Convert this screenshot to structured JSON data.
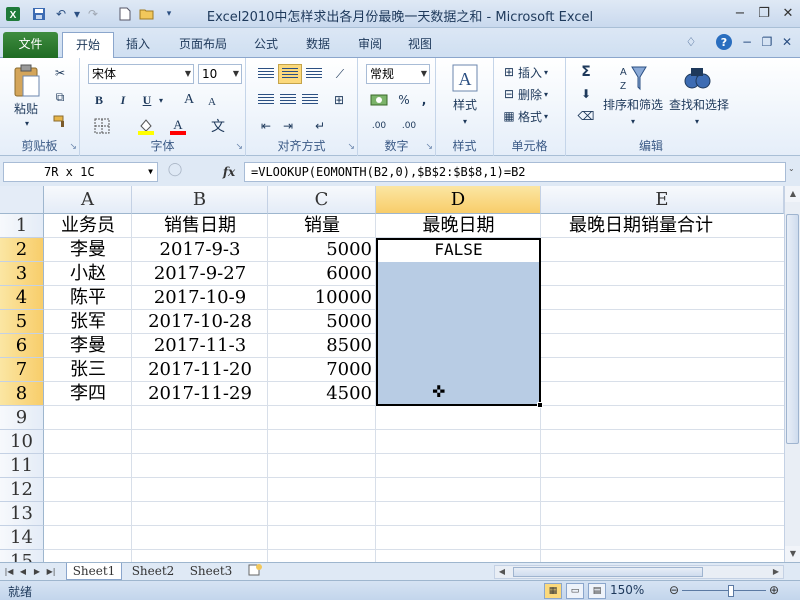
{
  "window": {
    "title": "Excel2010中怎样求出各月份最晚一天数据之和  -  Microsoft Excel"
  },
  "quick_access": {
    "save": "save-icon",
    "undo": "undo-icon",
    "redo": "redo-icon",
    "new": "new-file-icon",
    "open": "open-folder-icon"
  },
  "tabs": [
    "文件",
    "开始",
    "插入",
    "页面布局",
    "公式",
    "数据",
    "审阅",
    "视图"
  ],
  "active_tab": "开始",
  "ribbon": {
    "clipboard": {
      "label": "剪贴板",
      "paste": "粘贴"
    },
    "font": {
      "label": "字体",
      "name": "宋体",
      "size": "10",
      "bold": "B",
      "italic": "I",
      "underline": "U",
      "grow": "A",
      "shrink": "A",
      "wen": "文"
    },
    "alignment": {
      "label": "对齐方式"
    },
    "number": {
      "label": "数字",
      "format": "常规",
      "percent": "%",
      "comma": ",",
      "dec_inc": ".00",
      "dec_dec": ".00"
    },
    "styles": {
      "label": "样式",
      "button": "样式"
    },
    "cells": {
      "label": "单元格",
      "insert": "插入",
      "delete": "删除",
      "format": "格式"
    },
    "editing": {
      "label": "编辑",
      "sum": "Σ",
      "sort": "排序和筛选",
      "find": "查找和选择"
    }
  },
  "formula_bar": {
    "name_box": "7R x 1C",
    "fx": "fx",
    "formula": "=VLOOKUP(EOMONTH(B2,0),$B$2:$B$8,1)=B2"
  },
  "columns": [
    "A",
    "B",
    "C",
    "D",
    "E"
  ],
  "selected_column": "D",
  "rows": [
    "1",
    "2",
    "3",
    "4",
    "5",
    "6",
    "7",
    "8",
    "9",
    "10",
    "11",
    "12",
    "13",
    "14",
    "15"
  ],
  "selected_rows": [
    "2",
    "3",
    "4",
    "5",
    "6",
    "7",
    "8"
  ],
  "headers": {
    "a": "业务员",
    "b": "销售日期",
    "c": "销量",
    "d": "最晚日期",
    "e": "最晚日期销量合计"
  },
  "data_rows": [
    {
      "a": "李曼",
      "b": "2017-9-3",
      "c": "5000",
      "d": "FALSE"
    },
    {
      "a": "小赵",
      "b": "2017-9-27",
      "c": "6000",
      "d": ""
    },
    {
      "a": "陈平",
      "b": "2017-10-9",
      "c": "10000",
      "d": ""
    },
    {
      "a": "张军",
      "b": "2017-10-28",
      "c": "5000",
      "d": ""
    },
    {
      "a": "李曼",
      "b": "2017-11-3",
      "c": "8500",
      "d": ""
    },
    {
      "a": "张三",
      "b": "2017-11-20",
      "c": "7000",
      "d": ""
    },
    {
      "a": "李四",
      "b": "2017-11-29",
      "c": "4500",
      "d": ""
    }
  ],
  "sheets": [
    "Sheet1",
    "Sheet2",
    "Sheet3"
  ],
  "active_sheet": "Sheet1",
  "status": {
    "text": "就绪",
    "zoom": "150%",
    "zoom_level_percent": 150
  },
  "colors": {
    "file_tab": "#2a7a2e",
    "selection": "#b8cce4",
    "header_highlight": "#f8cd6a"
  }
}
